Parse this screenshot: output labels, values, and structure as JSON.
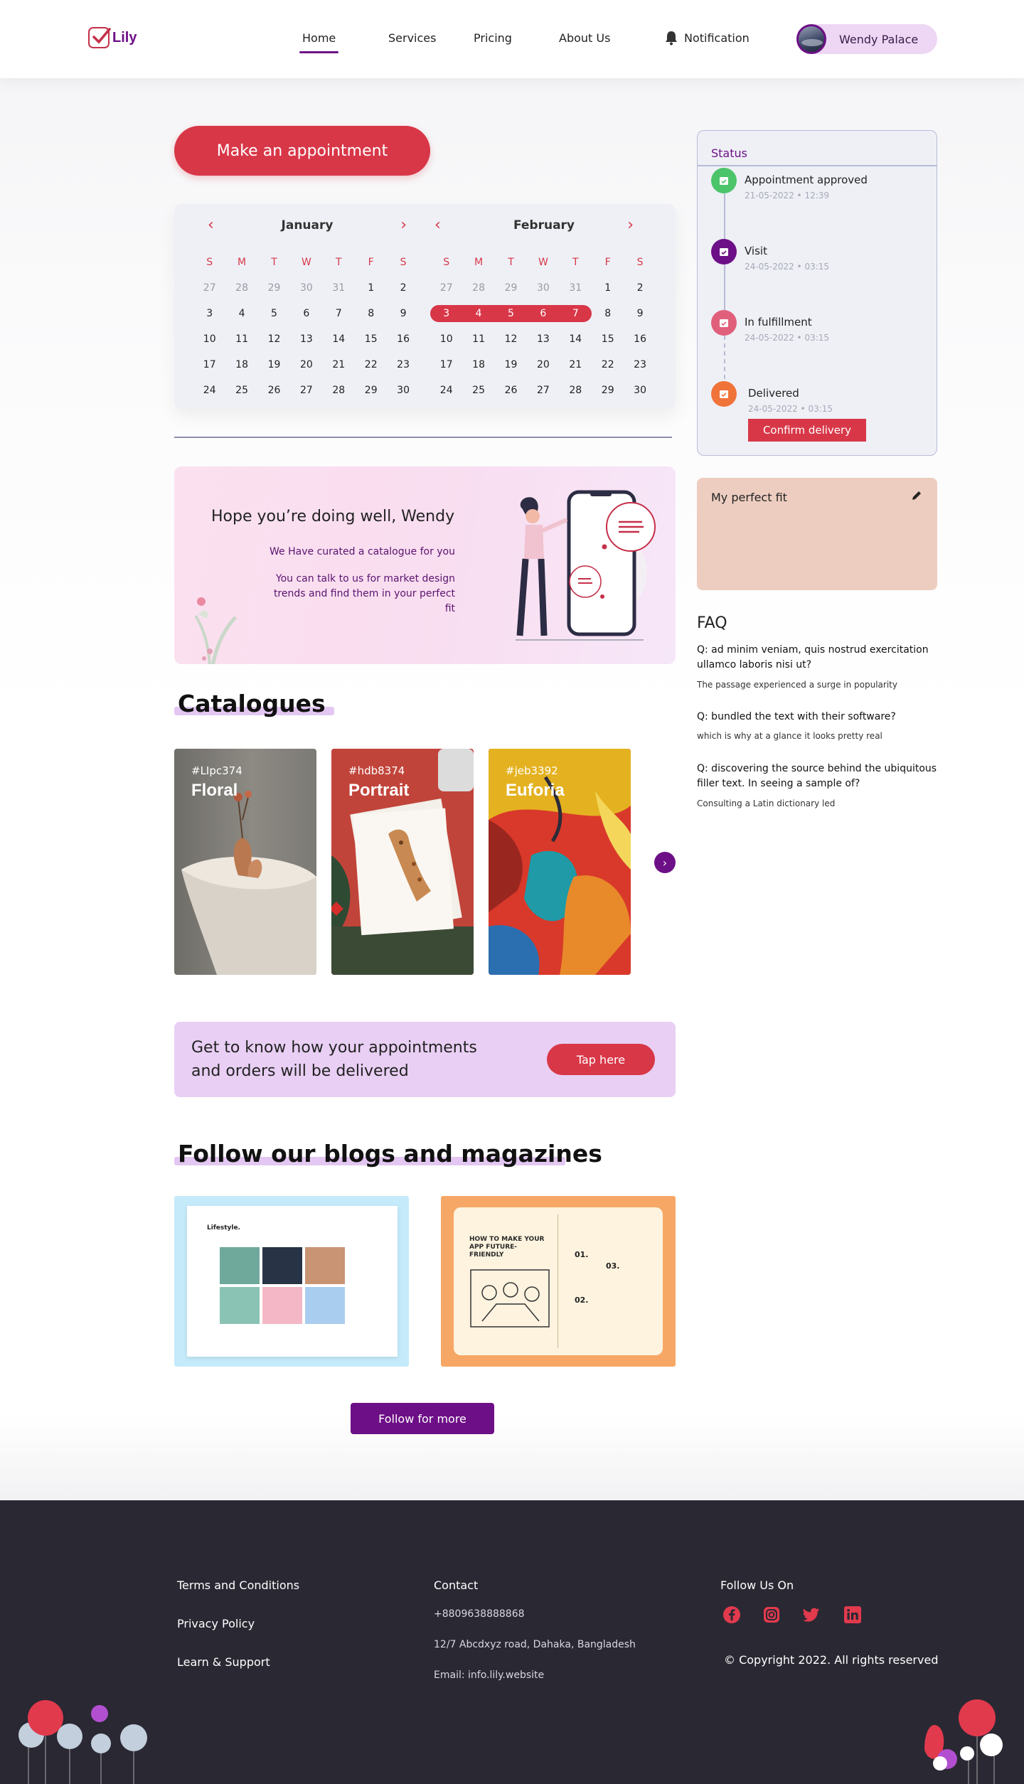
{
  "brand": {
    "name": "Lily"
  },
  "nav": {
    "items": [
      "Home",
      "Services",
      "Pricing",
      "About Us"
    ],
    "active": "Home",
    "notification_label": "Notification",
    "user_name": "Wendy Palace"
  },
  "appointment_button": "Make an appointment",
  "calendar": {
    "weekdays": [
      "S",
      "M",
      "T",
      "W",
      "T",
      "F",
      "S"
    ],
    "months": [
      {
        "name": "January",
        "weeks": [
          [
            "27",
            "28",
            "29",
            "30",
            "31",
            "1",
            "2"
          ],
          [
            "3",
            "4",
            "5",
            "6",
            "7",
            "8",
            "9"
          ],
          [
            "10",
            "11",
            "12",
            "13",
            "14",
            "15",
            "16"
          ],
          [
            "17",
            "18",
            "19",
            "20",
            "21",
            "22",
            "23"
          ],
          [
            "24",
            "25",
            "26",
            "27",
            "28",
            "29",
            "30"
          ]
        ]
      },
      {
        "name": "February",
        "weeks": [
          [
            "27",
            "28",
            "29",
            "30",
            "31",
            "1",
            "2"
          ],
          [
            "3",
            "4",
            "5",
            "6",
            "7",
            "8",
            "9"
          ],
          [
            "10",
            "11",
            "12",
            "13",
            "14",
            "15",
            "16"
          ],
          [
            "17",
            "18",
            "19",
            "20",
            "21",
            "22",
            "23"
          ],
          [
            "24",
            "25",
            "26",
            "27",
            "28",
            "29",
            "30"
          ]
        ],
        "selected_range": [
          "3",
          "7"
        ]
      }
    ]
  },
  "welcome": {
    "title": "Hope you’re doing well, Wendy",
    "line1": "We Have curated a catalogue for you",
    "line2": "You can talk to us for market design trends and find them in your perfect fit"
  },
  "catalogues": {
    "title": "Catalogues",
    "items": [
      {
        "tag": "#LIpc374",
        "name": "Floral"
      },
      {
        "tag": "#hdb8374",
        "name": "Portrait"
      },
      {
        "tag": "#jeb3392",
        "name": "Euforia"
      }
    ]
  },
  "delivery_banner": {
    "text": "Get to know how your appointments and orders will be delivered",
    "button": "Tap here"
  },
  "blogs": {
    "title": "Follow our blogs and magazines",
    "button": "Follow for more",
    "blog1_heading": "Lifestyle.",
    "blog2_heading": "HOW TO MAKE YOUR APP FUTURE-FRIENDLY"
  },
  "status": {
    "title": "Status",
    "steps": [
      {
        "label": "Appointment approved",
        "date": "21-05-2022 • 12:39"
      },
      {
        "label": "Visit",
        "date": "24-05-2022 • 03:15"
      },
      {
        "label": "In fulfillment",
        "date": "24-05-2022 • 03:15"
      },
      {
        "label": "Delivered",
        "date": "24-05-2022 • 03:15"
      }
    ],
    "confirm_button": "Confirm delivery"
  },
  "perfect_fit": {
    "title": "My perfect fit"
  },
  "faq": {
    "title": "FAQ",
    "items": [
      {
        "q": "Q: ad minim veniam, quis nostrud exercitation ullamco laboris nisi ut?",
        "a": "The passage experienced a surge in popularity"
      },
      {
        "q": "Q: bundled the text with their software?",
        "a": "which is why at a glance it looks pretty real"
      },
      {
        "q": "Q: discovering the source behind the ubiquitous filler text. In seeing a sample of?",
        "a": "Consulting a Latin dictionary led"
      }
    ]
  },
  "footer": {
    "links": [
      "Terms and Conditions",
      "Privacy Policy",
      "Learn & Support"
    ],
    "contact_title": "Contact",
    "phone": "+8809638888868",
    "address": "12/7 Abcdxyz road, Dahaka, Bangladesh",
    "email": "Email: info.lily.website",
    "follow_title": "Follow Us On",
    "socials": [
      "facebook-icon",
      "instagram-icon",
      "twitter-icon",
      "linkedin-icon"
    ],
    "copyright": "© Copyright 2022. All rights reserved"
  },
  "colors": {
    "accent": "#d83748",
    "brand": "#6d0f86",
    "footer": "#2a2833"
  }
}
